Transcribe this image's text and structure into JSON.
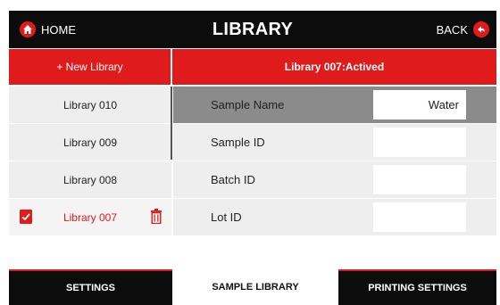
{
  "header": {
    "home_label": "HOME",
    "title": "LIBRARY",
    "back_label": "BACK"
  },
  "subheader": {
    "new_library_label": "+ New Library",
    "status_text": "Library 007:Actived"
  },
  "libraries": [
    {
      "label": "Library 010",
      "active": false
    },
    {
      "label": "Library 009",
      "active": false
    },
    {
      "label": "Library 008",
      "active": false
    },
    {
      "label": "Library 007",
      "active": true
    }
  ],
  "fields": [
    {
      "label": "Sample Name",
      "value": "Water"
    },
    {
      "label": "Sample ID",
      "value": ""
    },
    {
      "label": "Batch ID",
      "value": ""
    },
    {
      "label": "Lot ID",
      "value": ""
    }
  ],
  "tabs": [
    {
      "label": "SETTINGS",
      "selected": false
    },
    {
      "label": "SAMPLE LIBRARY",
      "selected": true
    },
    {
      "label": "PRINTING SETTINGS",
      "selected": false
    }
  ],
  "colors": {
    "accent": "#e01b1b",
    "header_bg": "#0c0c0c",
    "row_bg": "#eeeeee",
    "selected_field_row": "#8b8b8b"
  },
  "icons": {
    "home": "home-icon",
    "back": "back-arrow-icon",
    "active_library": "library-check-icon",
    "delete": "trash-icon"
  }
}
